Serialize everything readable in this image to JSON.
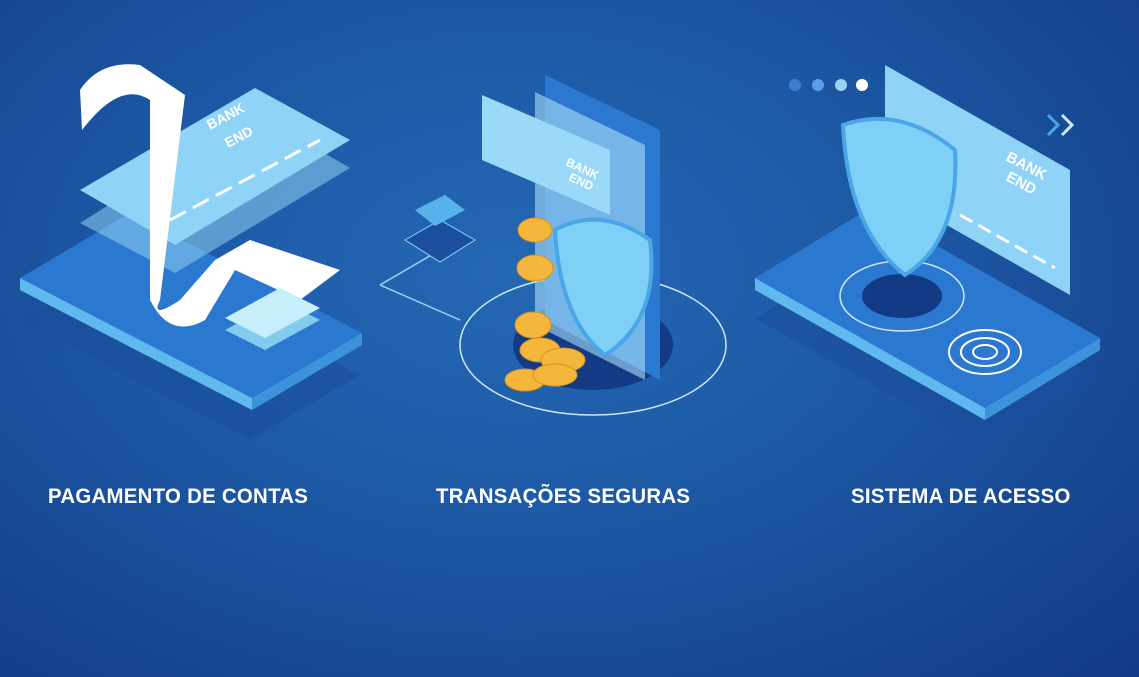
{
  "features": [
    {
      "label": "PAGAMENTO DE CONTAS",
      "card_text": [
        "BANK",
        "END"
      ]
    },
    {
      "label": "TRANSAÇÕES SEGURAS",
      "card_text": [
        "BANK",
        "END"
      ]
    },
    {
      "label": "SISTEMA DE ACESSO",
      "card_text": [
        "BANK",
        "END"
      ]
    }
  ],
  "colors": {
    "background": "#1d5aa6",
    "light": "#7fd0f7",
    "coin": "#f5b63c"
  }
}
